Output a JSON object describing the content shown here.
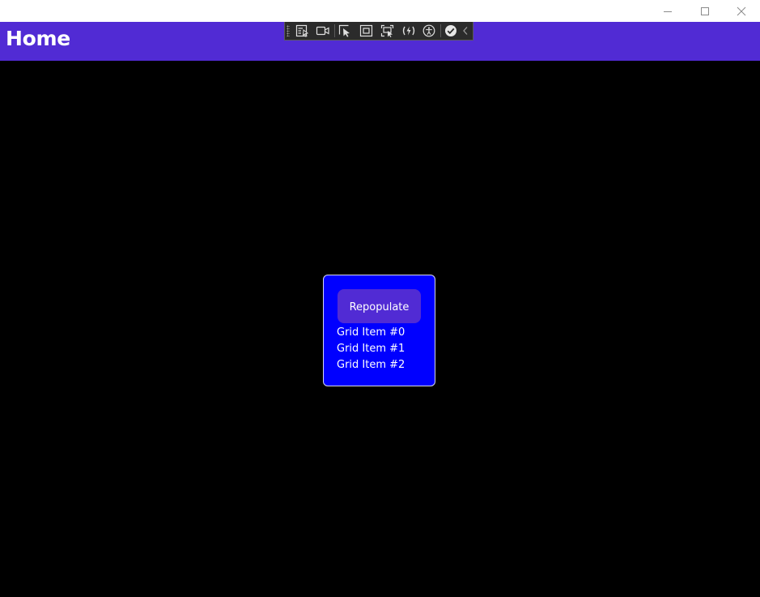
{
  "window": {
    "controls": [
      {
        "name": "minimize",
        "icon": "minimize-icon"
      },
      {
        "name": "maximize",
        "icon": "maximize-icon"
      },
      {
        "name": "close",
        "icon": "close-icon"
      }
    ]
  },
  "header": {
    "title": "Home",
    "background": "#512bd4"
  },
  "devtools_toolbar": {
    "tools": [
      "go-to-live-visual-tree-icon",
      "show-in-app-toolbar-video-icon",
      "select-element-icon",
      "display-layout-adorners-icon",
      "track-focused-element-icon",
      "hot-reload-icon",
      "accessibility-checker-icon",
      "binding-failures-check-icon",
      "collapse-toolbar-chevron-icon"
    ]
  },
  "main": {
    "background": "#000000",
    "card": {
      "background": "#0000ff",
      "button_label": "Repopulate",
      "items": [
        "Grid Item #0",
        "Grid Item #1",
        "Grid Item #2"
      ]
    }
  }
}
